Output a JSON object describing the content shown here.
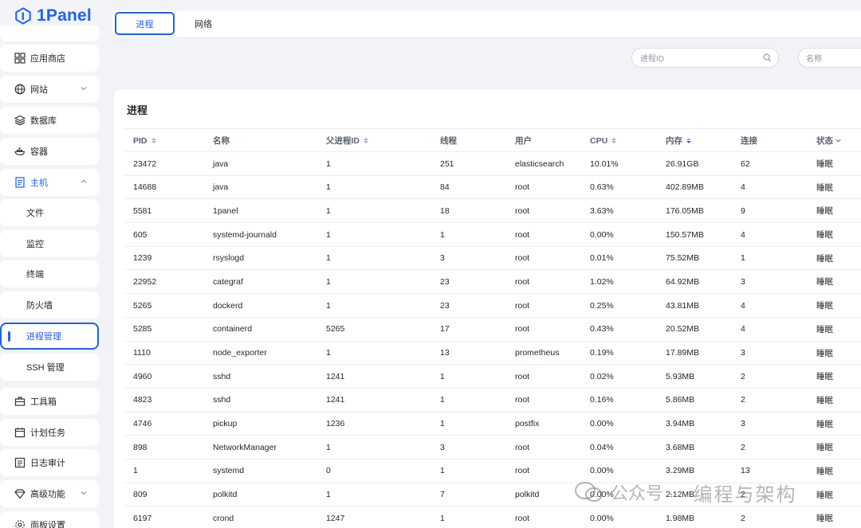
{
  "brand": {
    "name": "1Panel",
    "color": "#1f62f2"
  },
  "sidebar": {
    "items": [
      {
        "label": "应用商店",
        "icon": "grid-icon"
      },
      {
        "label": "网站",
        "icon": "globe-icon",
        "chevron": "down"
      },
      {
        "label": "数据库",
        "icon": "layers-icon"
      },
      {
        "label": "容器",
        "icon": "docker-icon"
      },
      {
        "label": "主机",
        "icon": "host-icon",
        "chevron": "up",
        "expanded": true
      },
      {
        "label": "文件",
        "sub": true
      },
      {
        "label": "监控",
        "sub": true
      },
      {
        "label": "终端",
        "sub": true
      },
      {
        "label": "防火墙",
        "sub": true
      },
      {
        "label": "进程管理",
        "sub": true,
        "active": true
      },
      {
        "label": "SSH 管理",
        "sub": true
      },
      {
        "label": "工具箱",
        "icon": "toolbox-icon"
      },
      {
        "label": "计划任务",
        "icon": "calendar-icon"
      },
      {
        "label": "日志审计",
        "icon": "log-icon"
      },
      {
        "label": "高级功能",
        "icon": "diamond-icon",
        "chevron": "down"
      },
      {
        "label": "面板设置",
        "icon": "gear-icon"
      }
    ]
  },
  "tabs": [
    {
      "label": "进程",
      "active": true
    },
    {
      "label": "网络",
      "active": false
    }
  ],
  "filters": {
    "pid_placeholder": "进程ID",
    "name_placeholder": "名称"
  },
  "table": {
    "title": "进程",
    "columns": [
      "PID",
      "名称",
      "父进程ID",
      "线程",
      "用户",
      "CPU",
      "内存",
      "连接",
      "状态"
    ],
    "sort_active": {
      "column": "内存",
      "direction": "desc"
    },
    "rows": [
      [
        "23472",
        "java",
        "1",
        "251",
        "elasticsearch",
        "10.01%",
        "26.91GB",
        "62",
        "睡眠"
      ],
      [
        "14688",
        "java",
        "1",
        "84",
        "root",
        "0.63%",
        "402.89MB",
        "4",
        "睡眠"
      ],
      [
        "5581",
        "1panel",
        "1",
        "18",
        "root",
        "3.63%",
        "176.05MB",
        "9",
        "睡眠"
      ],
      [
        "605",
        "systemd-journald",
        "1",
        "1",
        "root",
        "0.00%",
        "150.57MB",
        "4",
        "睡眠"
      ],
      [
        "1239",
        "rsyslogd",
        "1",
        "3",
        "root",
        "0.01%",
        "75.52MB",
        "1",
        "睡眠"
      ],
      [
        "22952",
        "categraf",
        "1",
        "23",
        "root",
        "1.02%",
        "64.92MB",
        "3",
        "睡眠"
      ],
      [
        "5265",
        "dockerd",
        "1",
        "23",
        "root",
        "0.25%",
        "43.81MB",
        "4",
        "睡眠"
      ],
      [
        "5285",
        "containerd",
        "5265",
        "17",
        "root",
        "0.43%",
        "20.52MB",
        "4",
        "睡眠"
      ],
      [
        "1110",
        "node_exporter",
        "1",
        "13",
        "prometheus",
        "0.19%",
        "17.89MB",
        "3",
        "睡眠"
      ],
      [
        "4960",
        "sshd",
        "1241",
        "1",
        "root",
        "0.02%",
        "5.93MB",
        "2",
        "睡眠"
      ],
      [
        "4823",
        "sshd",
        "1241",
        "1",
        "root",
        "0.16%",
        "5.86MB",
        "2",
        "睡眠"
      ],
      [
        "4746",
        "pickup",
        "1236",
        "1",
        "postfix",
        "0.00%",
        "3.94MB",
        "3",
        "睡眠"
      ],
      [
        "898",
        "NetworkManager",
        "1",
        "3",
        "root",
        "0.04%",
        "3.68MB",
        "2",
        "睡眠"
      ],
      [
        "1",
        "systemd",
        "0",
        "1",
        "root",
        "0.00%",
        "3.29MB",
        "13",
        "睡眠"
      ],
      [
        "809",
        "polkitd",
        "1",
        "7",
        "polkitd",
        "0.00%",
        "2.12MB",
        "2",
        "睡眠"
      ],
      [
        "6197",
        "crond",
        "1247",
        "1",
        "root",
        "0.00%",
        "1.98MB",
        "2",
        "睡眠"
      ]
    ]
  },
  "watermark": {
    "left": "公众号 ·",
    "right": "编程与架构"
  }
}
